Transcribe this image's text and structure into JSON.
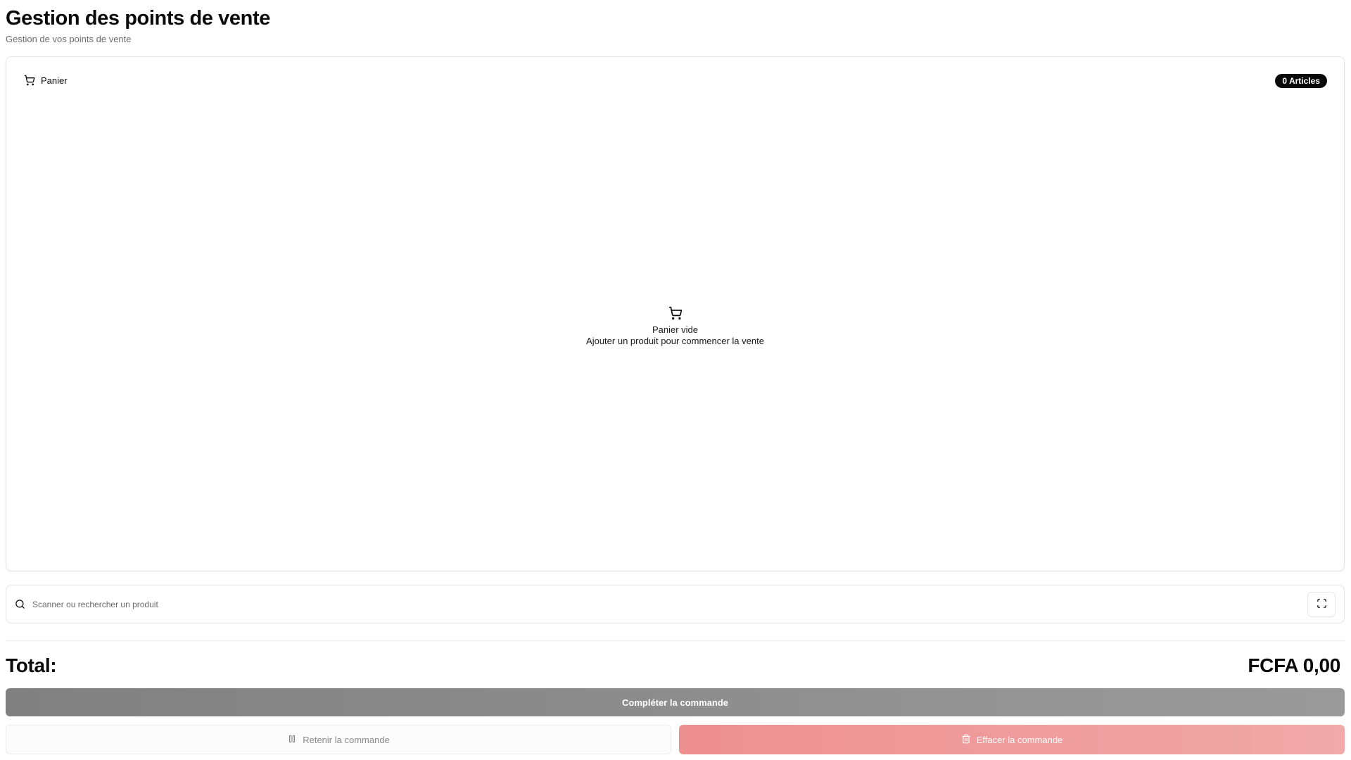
{
  "header": {
    "title": "Gestion des points de vente",
    "subtitle": "Gestion de vos points de vente"
  },
  "cart": {
    "title": "Panier",
    "title_icon": "cart-icon",
    "badge": "0 Articles",
    "empty_icon": "cart-icon",
    "empty_title": "Panier vide",
    "empty_message": "Ajouter un produit pour commencer la vente"
  },
  "search": {
    "icon": "search-icon",
    "placeholder": "Scanner ou rechercher un produit",
    "value": "",
    "scan_icon": "scan-icon"
  },
  "summary": {
    "total_label": "Total:",
    "total_value": "FCFA 0,00"
  },
  "actions": {
    "complete_label": "Compléter la commande",
    "hold_label": "Retenir la commande",
    "hold_icon": "pause-icon",
    "clear_label": "Effacer la commande",
    "clear_icon": "trash-icon"
  },
  "colors": {
    "complete_bg": "#808080",
    "clear_bg": "#ee8f8f",
    "badge_bg": "#0a0a0a"
  }
}
